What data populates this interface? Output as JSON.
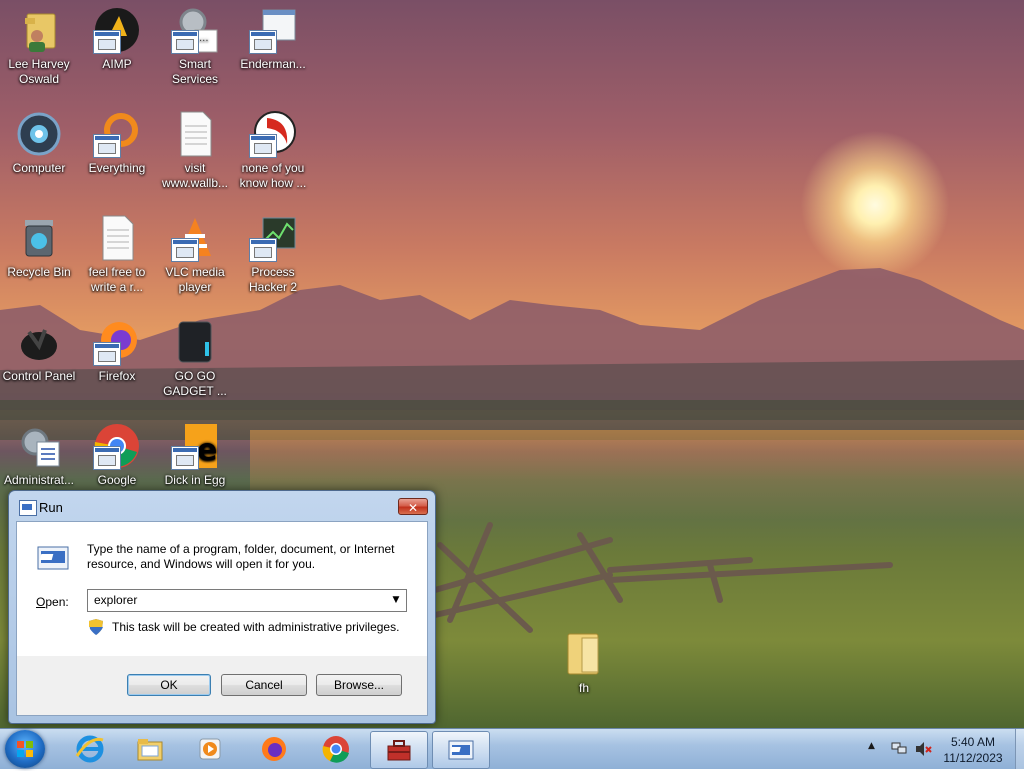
{
  "desktop": {
    "icons": [
      {
        "label": "Lee Harvey Oswald",
        "icon": "folder-user-icon"
      },
      {
        "label": "AIMP",
        "icon": "aimp-icon"
      },
      {
        "label": "Smart Services",
        "icon": "gears-icon"
      },
      {
        "label": "Enderman...",
        "icon": "window-app-icon"
      },
      {
        "label": "Computer",
        "icon": "computer-icon"
      },
      {
        "label": "Everything",
        "icon": "everything-icon"
      },
      {
        "label": "visit www.wallb...",
        "icon": "text-file-icon"
      },
      {
        "label": "none of you know how ...",
        "icon": "red-app-icon"
      },
      {
        "label": "Recycle Bin",
        "icon": "recycle-bin-icon"
      },
      {
        "label": "feel free to write a r...",
        "icon": "text-file-icon"
      },
      {
        "label": "VLC media player",
        "icon": "vlc-icon"
      },
      {
        "label": "Process Hacker 2",
        "icon": "process-hacker-icon"
      },
      {
        "label": "Control Panel",
        "icon": "control-panel-icon"
      },
      {
        "label": "Firefox",
        "icon": "firefox-icon"
      },
      {
        "label": "GO GO GADGET ...",
        "icon": "gadget-icon"
      },
      {
        "label": "Administrat...",
        "icon": "admin-tools-icon"
      },
      {
        "label": "Google",
        "icon": "chrome-icon"
      },
      {
        "label": "Dick in Egg",
        "icon": "egg-app-icon"
      },
      {
        "label": "fh",
        "icon": "folder-icon"
      }
    ]
  },
  "run_dialog": {
    "title": "Run",
    "close_glyph": "✕",
    "description": "Type the name of a program, folder, document, or Internet resource, and Windows will open it for you.",
    "open_label_prefix": "O",
    "open_label_rest": "pen:",
    "open_value": "explorer",
    "admin_notice": "This task will be created with administrative privileges.",
    "ok_label": "OK",
    "cancel_label": "Cancel",
    "browse_label": "Browse..."
  },
  "taskbar": {
    "pinned": [
      "internet-explorer-icon",
      "file-explorer-icon",
      "media-player-icon",
      "firefox-icon",
      "chrome-icon",
      "toolbox-icon",
      "run-window-icon"
    ],
    "time": "5:40 AM",
    "date": "11/12/2023"
  },
  "colors": {
    "accent": "#3c7fb1",
    "close": "#c1321d",
    "taskbar": "#a6c2e2"
  }
}
